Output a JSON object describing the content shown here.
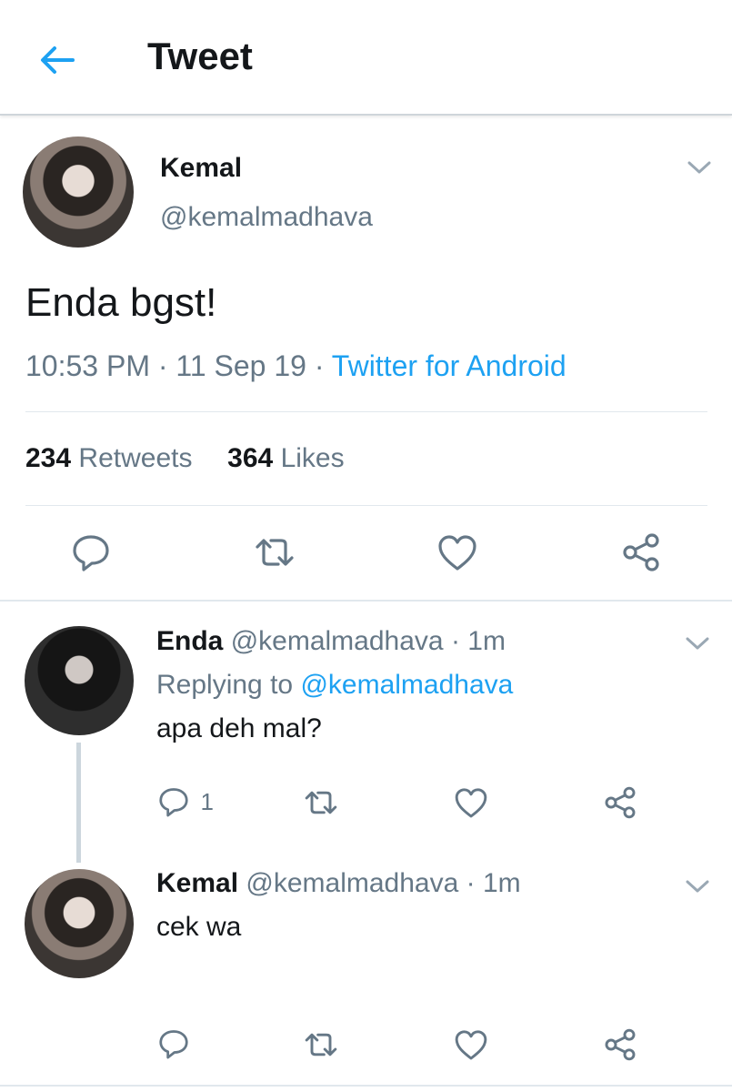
{
  "header": {
    "title": "Tweet"
  },
  "main_tweet": {
    "name": "Kemal",
    "handle": "@kemalmadhava",
    "text": "Enda bgst!",
    "time": "10:53 PM",
    "date": "11 Sep 19",
    "source": "Twitter for Android",
    "retweets_count": "234",
    "retweets_label": "Retweets",
    "likes_count": "364",
    "likes_label": "Likes"
  },
  "replies": [
    {
      "name": "Enda",
      "handle": "@kemalmadhava",
      "age": "1m",
      "replying_prefix": "Replying to",
      "replying_to": "@kemalmadhava",
      "text": "apa deh mal?",
      "reply_count": "1"
    },
    {
      "name": "Kemal",
      "handle": "@kemalmadhava",
      "age": "1m",
      "text": "cek wa"
    }
  ],
  "colors": {
    "accent": "#1da1f2",
    "muted": "#657786",
    "text": "#14171a",
    "divider": "#e1e8ed"
  },
  "icons": [
    "back-arrow-icon",
    "chevron-down-icon",
    "reply-icon",
    "retweet-icon",
    "like-icon",
    "share-icon"
  ]
}
